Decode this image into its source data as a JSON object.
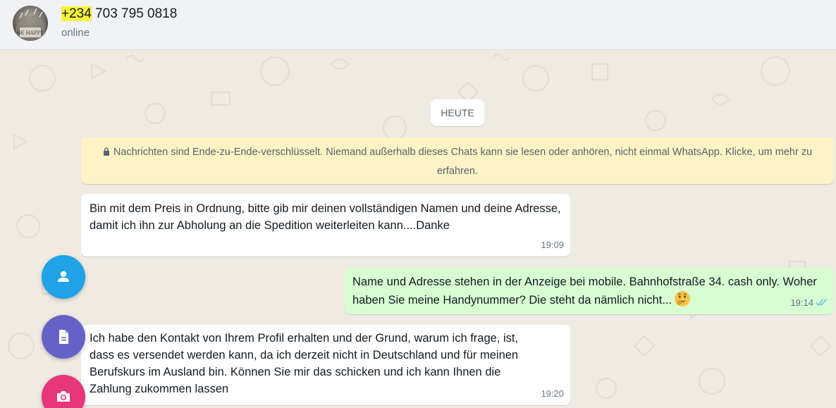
{
  "header": {
    "avatar_text": "BE HAPPY",
    "contact_prefix": "+234",
    "contact_rest": " 703 795 0818",
    "status": "online"
  },
  "chat": {
    "date_chip": "HEUTE",
    "encryption_notice": "Nachrichten sind Ende-zu-Ende-verschlüsselt. Niemand außerhalb dieses Chats kann sie lesen oder anhören, nicht einmal WhatsApp. Klicke, um mehr zu erfahren.",
    "messages": [
      {
        "direction": "incoming",
        "text": "Bin mit dem Preis in Ordnung, bitte gib mir deinen vollständigen Namen und deine Adresse, damit ich ihn zur Abholung an die Spedition weiterleiten kann....Danke",
        "time": "19:09"
      },
      {
        "direction": "outgoing",
        "text": "Name und Adresse stehen in der Anzeige bei mobile. Bahnhofstraße 34. cash only. Woher haben Sie meine Handynummer? Die steht da nämlich nicht...",
        "emoji": "thinking-face",
        "time": "19:14",
        "status": "read"
      },
      {
        "direction": "incoming",
        "text": "Ich habe den Kontakt von Ihrem Profil erhalten und der Grund, warum ich frage, ist, dass es versendet werden kann, da ich derzeit nicht in Deutschland und für meinen Berufskurs im Ausland bin.  Können Sie mir das schicken und ich kann Ihnen die Zahlung zukommen lassen",
        "time": "19:20"
      }
    ]
  },
  "attach_menu": [
    {
      "icon": "contact-icon",
      "color": "#1fa2e6"
    },
    {
      "icon": "document-icon",
      "color": "#6562c7"
    },
    {
      "icon": "camera-icon",
      "color": "#e7367a"
    }
  ],
  "colors": {
    "header_bg": "#f0f2f5",
    "chat_bg": "#efeae2",
    "incoming_bubble": "#ffffff",
    "outgoing_bubble": "#d9fdd3",
    "notice_bg": "#fdf3c5",
    "read_ticks": "#53bdeb",
    "highlight": "#f7f33b"
  }
}
